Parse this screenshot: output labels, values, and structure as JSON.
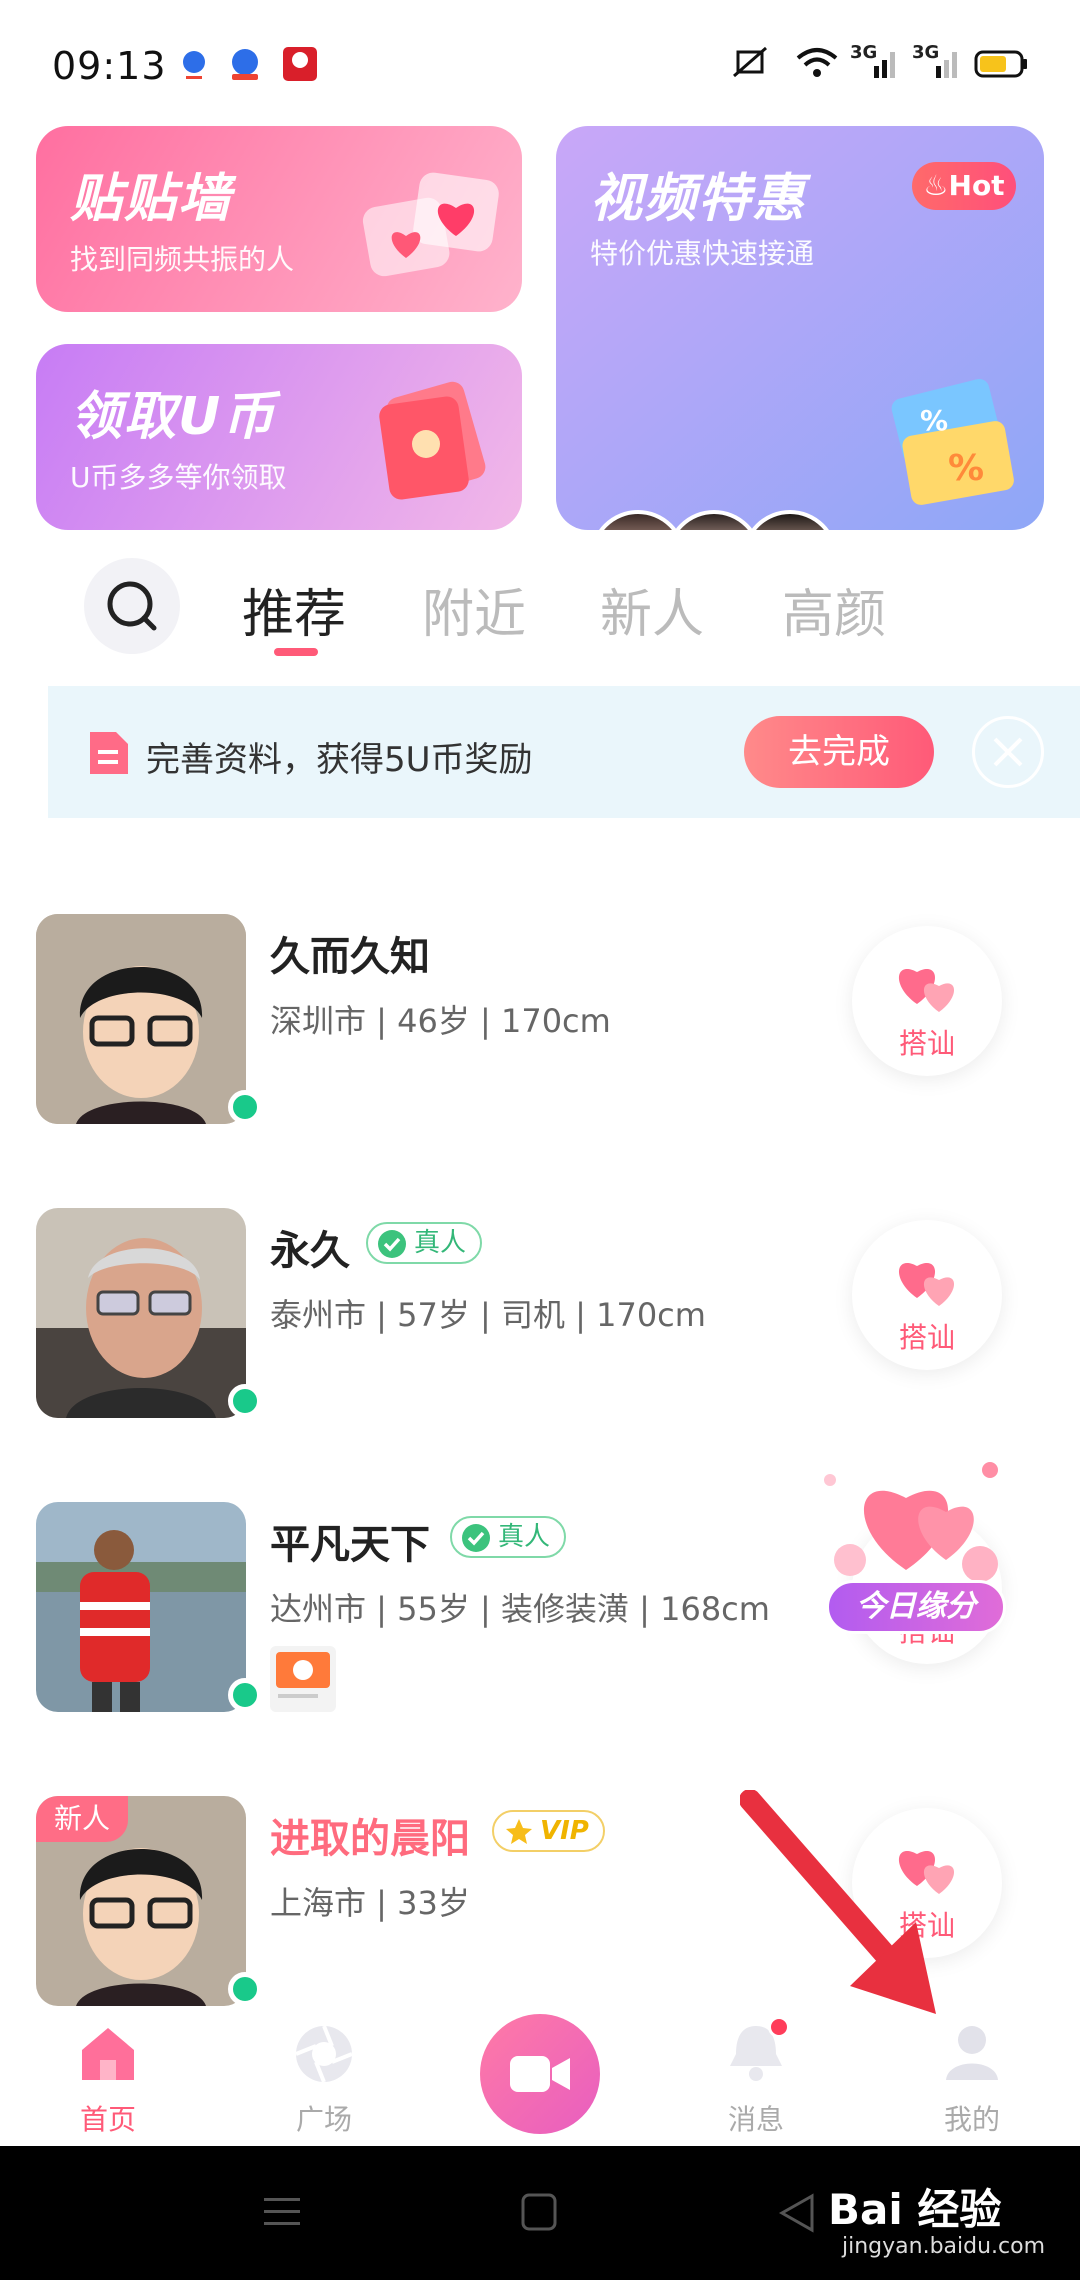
{
  "status": {
    "time": "09:13",
    "network1": "3G",
    "network2": "3G"
  },
  "promo": {
    "wall": {
      "title": "贴贴墙",
      "subtitle": "找到同频共振的人"
    },
    "video": {
      "title": "视频特惠",
      "subtitle": "特价优惠快速接通",
      "badge": "Hot"
    },
    "coin": {
      "title": "领取U币",
      "subtitle": "U币多多等你领取"
    }
  },
  "tabs": [
    {
      "label": "推荐",
      "active": true
    },
    {
      "label": "附近",
      "active": false
    },
    {
      "label": "新人",
      "active": false
    },
    {
      "label": "高颜",
      "active": false
    }
  ],
  "banner": {
    "text": "完善资料，获得5U币奖励",
    "button": "去完成"
  },
  "users": [
    {
      "name": "久而久知",
      "info": "深圳市 | 46岁 | 170cm",
      "badge": "",
      "action": "搭讪"
    },
    {
      "name": "永久",
      "info": "泰州市 | 57岁 | 司机 | 170cm",
      "badge": "真人",
      "action": "搭讪"
    },
    {
      "name": "平凡天下",
      "info": "达州市 | 55岁 | 装修装潢 | 168cm",
      "badge": "真人",
      "action": "搭讪"
    },
    {
      "name": "进取的晨阳",
      "info": "上海市 | 33岁",
      "badge": "VIP",
      "tag": "新人",
      "action": "搭讪"
    }
  ],
  "float_badge": "今日缘分",
  "nav": [
    {
      "label": "首页",
      "active": true
    },
    {
      "label": "广场",
      "active": false
    },
    {
      "label": "",
      "active": false
    },
    {
      "label": "消息",
      "active": false
    },
    {
      "label": "我的",
      "active": false
    }
  ],
  "watermark": {
    "brand": "Bai 经验",
    "url": "jingyan.baidu.com"
  },
  "colors": {
    "accent": "#ff5a78",
    "online": "#19c98a",
    "verified": "#33b778",
    "vip": "#f0b400"
  }
}
